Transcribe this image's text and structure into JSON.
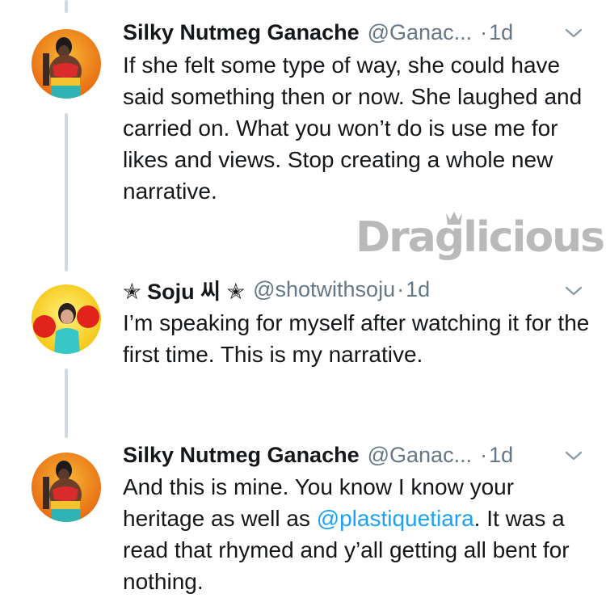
{
  "tweets": [
    {
      "name": "Silky Nutmeg Ganache",
      "handle": "@Ganac...",
      "dot": "·",
      "time": "1d",
      "text": "If she felt some type of way, she could have said something then or now. She laughed and carried on. What you won’t do is use me for likes and views. Stop creating a whole new narrative."
    },
    {
      "name": "✭ Soju 씨 ✭",
      "handle": "@shotwithsoju",
      "dot": "·",
      "time": "1d",
      "text": "I’m speaking for myself after watching it for the first time. This is my narrative."
    },
    {
      "name": "Silky Nutmeg Ganache",
      "handle": "@Ganac...",
      "dot": "·",
      "time": "1d",
      "text_before": "And this is mine. You know I know your heritage as well as ",
      "mention": "@plastiquetiara",
      "text_after": ". It was a read that rhymed and y’all getting all bent for nothing."
    }
  ],
  "watermark": {
    "text": "Draglicious"
  },
  "icons": {
    "avatar_1": "avatar-silky",
    "avatar_2": "avatar-soju",
    "avatar_3": "avatar-silky",
    "chevron": "chevron-down-icon"
  },
  "colors": {
    "name": "#14171a",
    "secondary": "#657786",
    "mention": "#1da1f2",
    "thread_line": "#cfd9de",
    "watermark": "#b9b9b9"
  }
}
